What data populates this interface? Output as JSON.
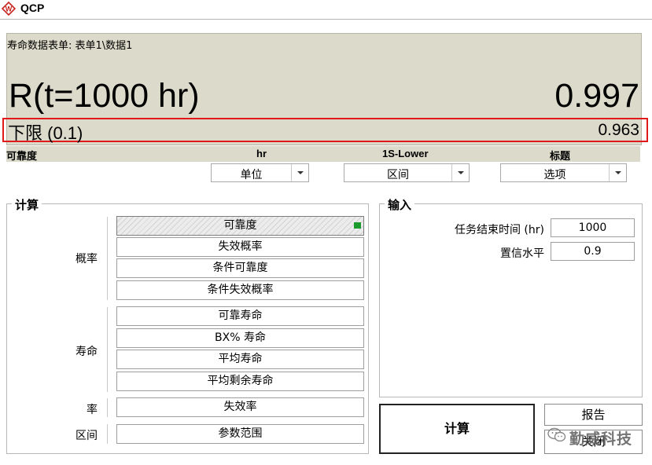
{
  "window": {
    "title": "QCP",
    "logo_text": "W"
  },
  "result": {
    "sheet_path": "寿命数据表单: 表单1\\数据1",
    "label": "R(t=1000 hr)",
    "value": "0.997",
    "bound_label": "下限 (0.1)",
    "bound_value": "0.963"
  },
  "headers": {
    "metric": "可靠度",
    "unit": "hr",
    "interval": "1S-Lower",
    "title": "标题"
  },
  "dropdowns": {
    "unit": "单位",
    "interval": "区间",
    "options": "选项"
  },
  "calc_group": {
    "title": "计算",
    "categories": {
      "probability": "概率",
      "life": "寿命",
      "rate": "率",
      "interval": "区间"
    },
    "probability_options": [
      "可靠度",
      "失效概率",
      "条件可靠度",
      "条件失效概率"
    ],
    "life_options": [
      "可靠寿命",
      "BX% 寿命",
      "平均寿命",
      "平均剩余寿命"
    ],
    "rate_options": [
      "失效率"
    ],
    "interval_options": [
      "参数范围"
    ],
    "selected_option": "可靠度"
  },
  "input_group": {
    "title": "输入",
    "mission_end_time_label": "任务结束时间 (hr)",
    "mission_end_time_value": "1000",
    "confidence_label": "置信水平",
    "confidence_value": "0.9"
  },
  "buttons": {
    "calculate": "计算",
    "report": "报告",
    "close": "关闭"
  },
  "watermark": "勤威科技",
  "colors": {
    "panel_bg": "#dcdbcb",
    "highlight_border": "#e01a1a",
    "selected_indicator": "#1b9a2e"
  }
}
